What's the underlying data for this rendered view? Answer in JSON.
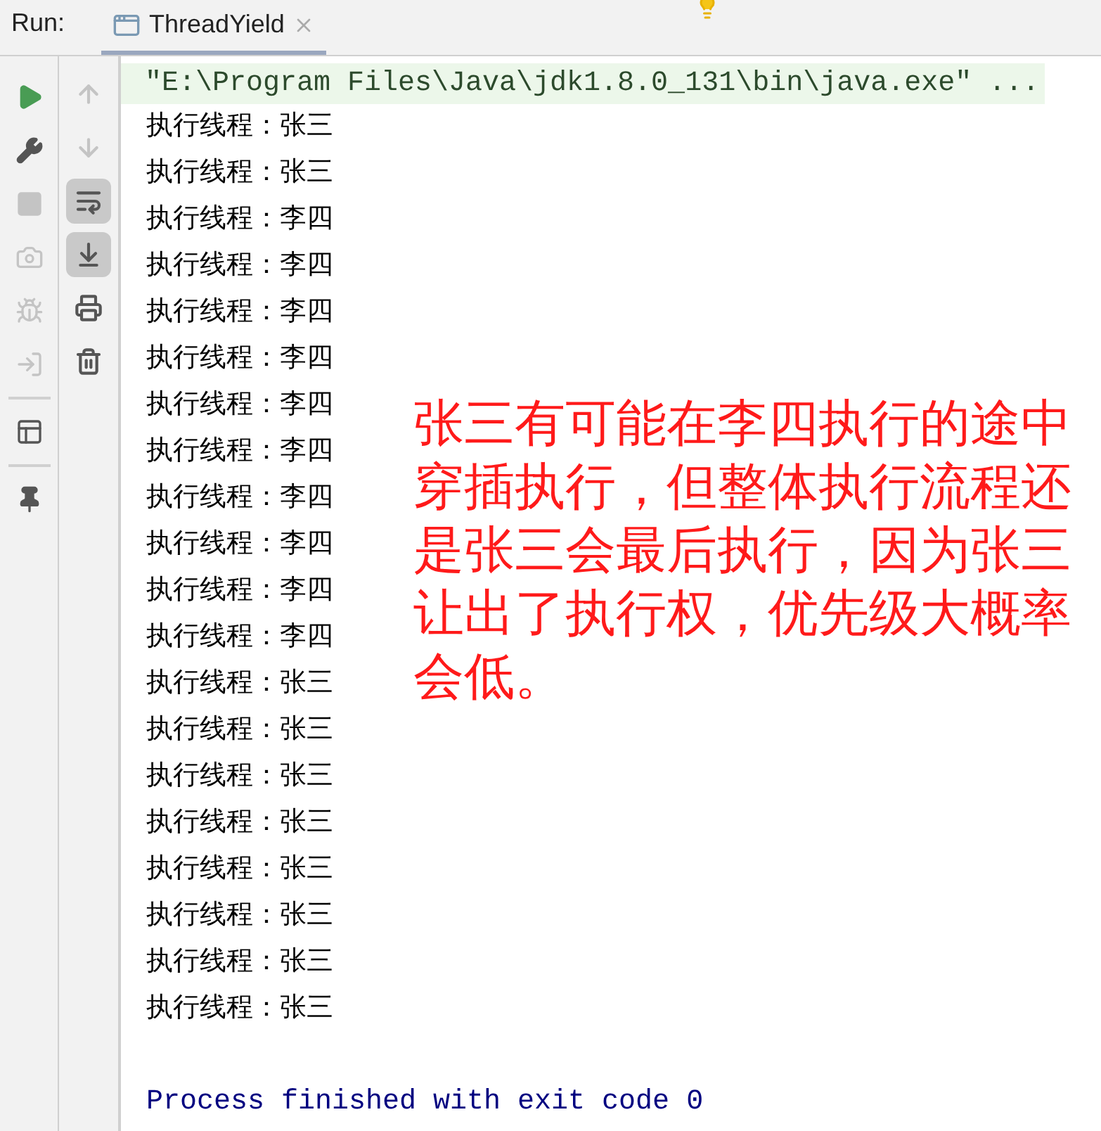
{
  "run_panel": {
    "label": "Run:",
    "tabs": [
      {
        "label": "ThreadYield",
        "selected": true
      }
    ]
  },
  "left_toolbar": [
    {
      "disabled": false
    },
    {
      "disabled": false
    },
    {
      "disabled": true
    },
    {
      "disabled": true
    },
    {
      "disabled": true
    },
    {
      "disabled": true
    },
    {
      "disabled": false
    },
    {
      "disabled": false
    }
  ],
  "console_toolbar": [
    {
      "disabled": true,
      "selected": false
    },
    {
      "disabled": true,
      "selected": false
    },
    {
      "disabled": false,
      "selected": true
    },
    {
      "disabled": false,
      "selected": true
    },
    {
      "disabled": false,
      "selected": false
    },
    {
      "disabled": false,
      "selected": false
    }
  ],
  "console": {
    "command": "\"E:\\Program Files\\Java\\jdk1.8.0_131\\bin\\java.exe\" ...",
    "lines": [
      "执行线程：张三",
      "执行线程：张三",
      "执行线程：李四",
      "执行线程：李四",
      "执行线程：李四",
      "执行线程：李四",
      "执行线程：李四",
      "执行线程：李四",
      "执行线程：李四",
      "执行线程：李四",
      "执行线程：李四",
      "执行线程：李四",
      "执行线程：张三",
      "执行线程：张三",
      "执行线程：张三",
      "执行线程：张三",
      "执行线程：张三",
      "执行线程：张三",
      "执行线程：张三",
      "执行线程：张三"
    ],
    "exit_message": "Process finished with exit code 0"
  },
  "annotation": "张三有可能在李四执行的途中穿插执行，但整体执行流程还是张三会最后执行，因为张三让出了执行权，优先级大概率会低。"
}
